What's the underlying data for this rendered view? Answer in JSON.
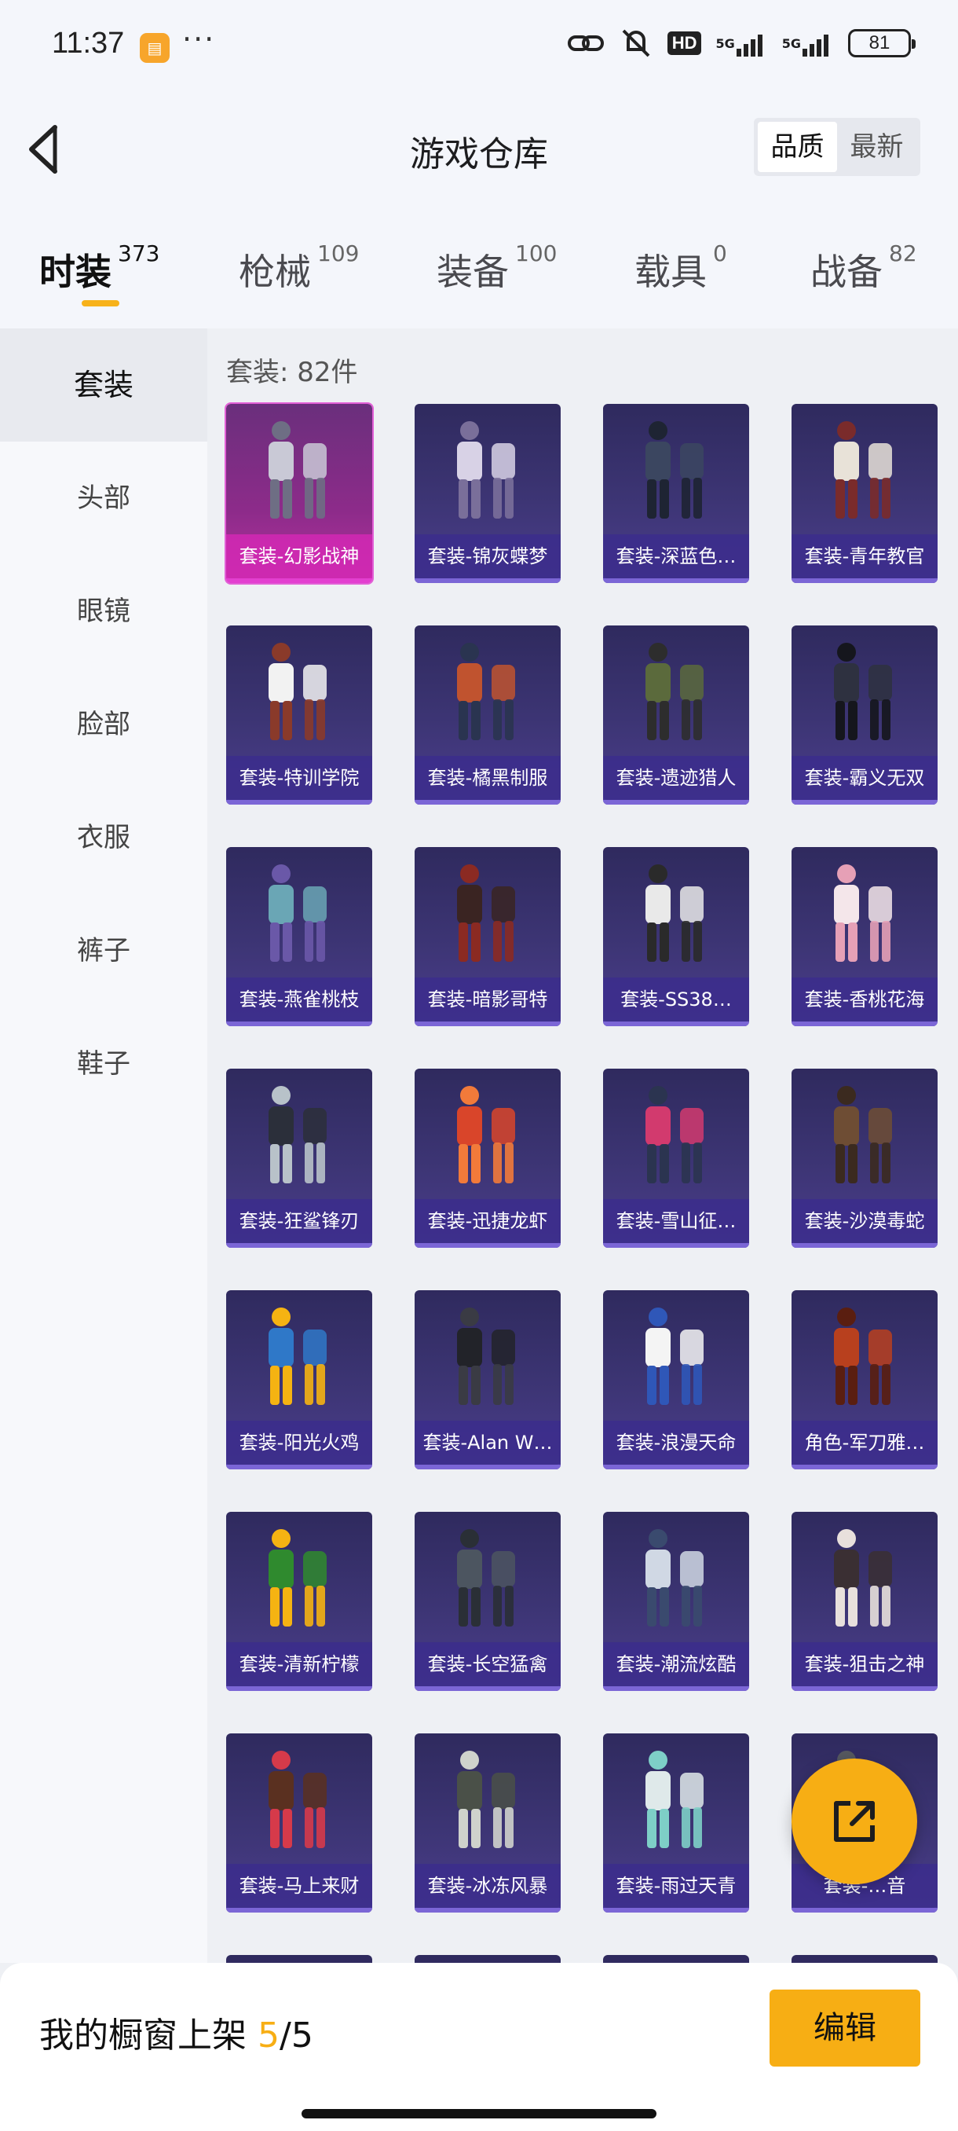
{
  "status_bar": {
    "time": "11:37",
    "app_badge": "▤",
    "more": "···",
    "hd": "HD",
    "net1": "5G",
    "net2": "5G",
    "battery": "81"
  },
  "header": {
    "title": "游戏仓库",
    "sort_options": [
      "品质",
      "最新"
    ],
    "sort_selected": "品质"
  },
  "tabs": [
    {
      "label": "时装",
      "count": "373",
      "active": true
    },
    {
      "label": "枪械",
      "count": "109",
      "active": false
    },
    {
      "label": "装备",
      "count": "100",
      "active": false
    },
    {
      "label": "载具",
      "count": "0",
      "active": false
    },
    {
      "label": "战备",
      "count": "82",
      "active": false
    }
  ],
  "sidebar": {
    "items": [
      "套装",
      "头部",
      "眼镜",
      "脸部",
      "衣服",
      "裤子",
      "鞋子"
    ],
    "selected": "套装"
  },
  "content": {
    "count_label": "套装: 82件",
    "items": [
      {
        "name": "套装-幻影战神",
        "rarity": "legendary"
      },
      {
        "name": "套装-锦灰蝶梦",
        "rarity": "epic"
      },
      {
        "name": "套装-深蓝色…",
        "rarity": "epic"
      },
      {
        "name": "套装-青年教官",
        "rarity": "epic"
      },
      {
        "name": "套装-特训学院",
        "rarity": "epic"
      },
      {
        "name": "套装-橘黑制服",
        "rarity": "epic"
      },
      {
        "name": "套装-遗迹猎人",
        "rarity": "epic"
      },
      {
        "name": "套装-霸义无双",
        "rarity": "epic"
      },
      {
        "name": "套装-燕雀桃枝",
        "rarity": "epic"
      },
      {
        "name": "套装-暗影哥特",
        "rarity": "epic"
      },
      {
        "name": "套装-SS38…",
        "rarity": "epic"
      },
      {
        "name": "套装-香桃花海",
        "rarity": "epic"
      },
      {
        "name": "套装-狂鲨锋刃",
        "rarity": "epic"
      },
      {
        "name": "套装-迅捷龙虾",
        "rarity": "epic"
      },
      {
        "name": "套装-雪山征…",
        "rarity": "epic"
      },
      {
        "name": "套装-沙漠毒蛇",
        "rarity": "epic"
      },
      {
        "name": "套装-阳光火鸡",
        "rarity": "epic"
      },
      {
        "name": "套装-Alan W…",
        "rarity": "epic"
      },
      {
        "name": "套装-浪漫天命",
        "rarity": "epic"
      },
      {
        "name": "角色-军刀雅…",
        "rarity": "epic"
      },
      {
        "name": "套装-清新柠檬",
        "rarity": "epic"
      },
      {
        "name": "套装-长空猛禽",
        "rarity": "epic"
      },
      {
        "name": "套装-潮流炫酷",
        "rarity": "epic"
      },
      {
        "name": "套装-狙击之神",
        "rarity": "epic"
      },
      {
        "name": "套装-马上来财",
        "rarity": "epic"
      },
      {
        "name": "套装-冰冻风暴",
        "rarity": "epic"
      },
      {
        "name": "套装-雨过天青",
        "rarity": "epic"
      },
      {
        "name": "套装-…音",
        "rarity": "epic"
      }
    ]
  },
  "fab": {
    "icon": "share-external-icon"
  },
  "bottom_bar": {
    "shelf_label": "我的橱窗上架",
    "shelf_current": "5",
    "shelf_sep_total": "/5",
    "edit_label": "编辑"
  },
  "colors": {
    "accent": "#f7ae14",
    "card_epic": "#3d3575",
    "card_legendary": "#b4329e"
  }
}
